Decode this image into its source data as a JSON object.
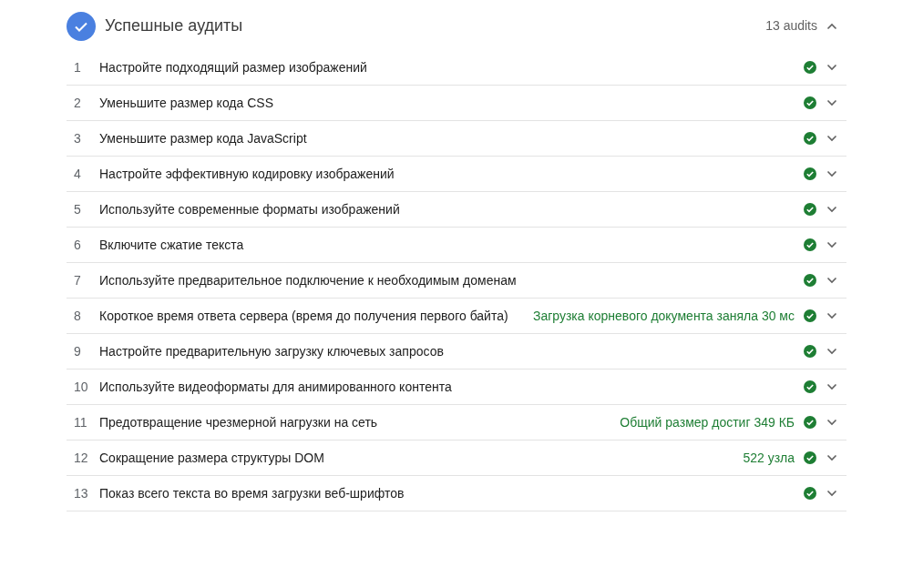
{
  "section": {
    "title": "Успешные аудиты",
    "count": "13 audits",
    "expanded": true
  },
  "audits": [
    {
      "number": "1",
      "title": "Настройте подходящий размер изображений",
      "expanded": false
    },
    {
      "number": "2",
      "title": "Уменьшите размер кода CSS",
      "expanded": false
    },
    {
      "number": "3",
      "title": "Уменьшите размер кода JavaScript",
      "expanded": false
    },
    {
      "number": "4",
      "title": "Настройте эффективную кодировку изображений",
      "expanded": false
    },
    {
      "number": "5",
      "title": "Используйте современные форматы изображений",
      "expanded": false
    },
    {
      "number": "6",
      "title": "Включите сжатие текста",
      "expanded": false
    },
    {
      "number": "7",
      "title": "Используйте предварительное подключение к необходимым доменам",
      "expanded": false
    },
    {
      "number": "8",
      "title": "Короткое время ответа сервера (время до получения первого байта)",
      "display_value": "Загрузка корневого документа заняла 30 мс",
      "expanded": false
    },
    {
      "number": "9",
      "title": "Настройте предварительную загрузку ключевых запросов",
      "expanded": false
    },
    {
      "number": "10",
      "title": "Используйте видеоформаты для анимированного контента",
      "expanded": false
    },
    {
      "number": "11",
      "title": "Предотвращение чрезмерной нагрузки на сеть",
      "display_value": "Общий размер достиг 349 КБ",
      "expanded": false
    },
    {
      "number": "12",
      "title": "Сокращение размера структуры DOM",
      "display_value": "522 узла",
      "expanded": false
    },
    {
      "number": "13",
      "title": "Показ всего текста во время загрузки веб-шрифтов",
      "expanded": false
    }
  ]
}
